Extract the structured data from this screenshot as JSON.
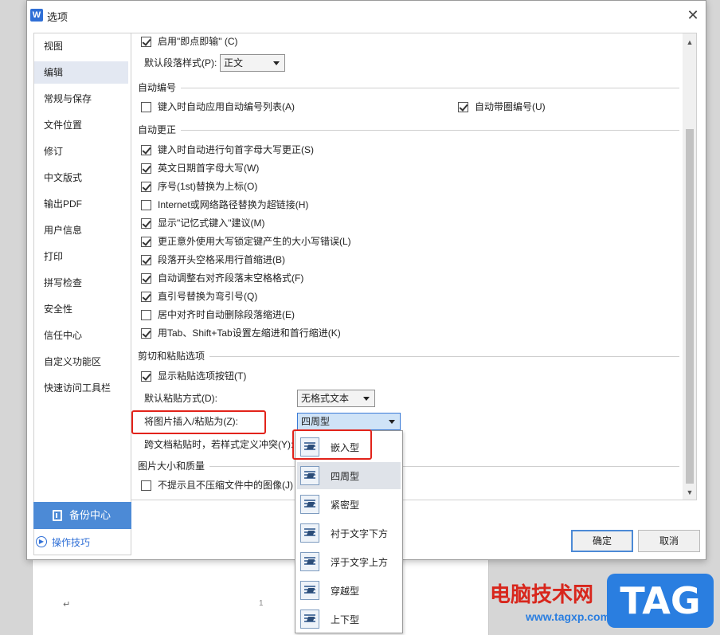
{
  "dialog": {
    "title": "选项",
    "logo": "W",
    "close_glyph": "✕"
  },
  "sidebar": {
    "items": [
      {
        "label": "视图"
      },
      {
        "label": "编辑",
        "active": true
      },
      {
        "label": "常规与保存"
      },
      {
        "label": "文件位置"
      },
      {
        "label": "修订"
      },
      {
        "label": "中文版式"
      },
      {
        "label": "输出PDF"
      },
      {
        "label": "用户信息"
      },
      {
        "label": "打印"
      },
      {
        "label": "拼写检查"
      },
      {
        "label": "安全性"
      },
      {
        "label": "信任中心"
      },
      {
        "label": "自定义功能区"
      },
      {
        "label": "快速访问工具栏"
      }
    ],
    "backup_label": "备份中心",
    "tips_label": "操作技巧"
  },
  "content": {
    "instant_input": {
      "label": "启用\"即点即输\" (C)",
      "checked": true
    },
    "default_para_style_label": "默认段落样式(P):",
    "default_para_style_value": "正文",
    "auto_number": {
      "heading": "自动编号",
      "apply_auto_list": {
        "label": "键入时自动应用自动编号列表(A)",
        "checked": false
      },
      "auto_circle_number": {
        "label": "自动带圈编号(U)",
        "checked": true
      }
    },
    "auto_correct": {
      "heading": "自动更正",
      "items": [
        {
          "label": "键入时自动进行句首字母大写更正(S)",
          "checked": true
        },
        {
          "label": "英文日期首字母大写(W)",
          "checked": true
        },
        {
          "label": "序号(1st)替换为上标(O)",
          "checked": true
        },
        {
          "label": "Internet或网络路径替换为超链接(H)",
          "checked": false
        },
        {
          "label": "显示\"记忆式键入\"建议(M)",
          "checked": true
        },
        {
          "label": "更正意外使用大写锁定键产生的大小写错误(L)",
          "checked": true
        },
        {
          "label": "段落开头空格采用行首缩进(B)",
          "checked": true
        },
        {
          "label": "自动调整右对齐段落末空格格式(F)",
          "checked": true
        },
        {
          "label": "直引号替换为弯引号(Q)",
          "checked": true
        },
        {
          "label": "居中对齐时自动删除段落缩进(E)",
          "checked": false
        },
        {
          "label": "用Tab、Shift+Tab设置左缩进和首行缩进(K)",
          "checked": true
        }
      ]
    },
    "paste": {
      "heading": "剪切和粘贴选项",
      "show_paste_button": {
        "label": "显示粘贴选项按钮(T)",
        "checked": true
      },
      "default_paste_label": "默认粘贴方式(D):",
      "default_paste_value": "无格式文本",
      "insert_image_label": "将图片插入/粘贴为(Z):",
      "insert_image_value": "四周型",
      "cross_doc_label": "跨文档粘贴时，若样式定义冲突(Y):"
    },
    "image_quality": {
      "heading": "图片大小和质量",
      "no_compress": {
        "label": "不提示且不压缩文件中的图像(J)",
        "checked": false
      }
    }
  },
  "dropdown": {
    "options": [
      {
        "label": "嵌入型",
        "icon": "wrap-inline-icon"
      },
      {
        "label": "四周型",
        "icon": "wrap-square-icon",
        "selected": true
      },
      {
        "label": "紧密型",
        "icon": "wrap-tight-icon"
      },
      {
        "label": "衬于文字下方",
        "icon": "wrap-behind-text-icon"
      },
      {
        "label": "浮于文字上方",
        "icon": "wrap-in-front-icon"
      },
      {
        "label": "穿越型",
        "icon": "wrap-through-icon"
      },
      {
        "label": "上下型",
        "icon": "wrap-top-bottom-icon"
      }
    ]
  },
  "buttons": {
    "ok": "确定",
    "cancel": "取消"
  },
  "document": {
    "return_mark": "↵",
    "page_number": "1"
  },
  "watermark": {
    "text": "电脑技术网",
    "url": "www.tagxp.com",
    "logo": "TAG"
  },
  "colors": {
    "highlight": "#e2231a",
    "accent": "#4c8ad6"
  }
}
